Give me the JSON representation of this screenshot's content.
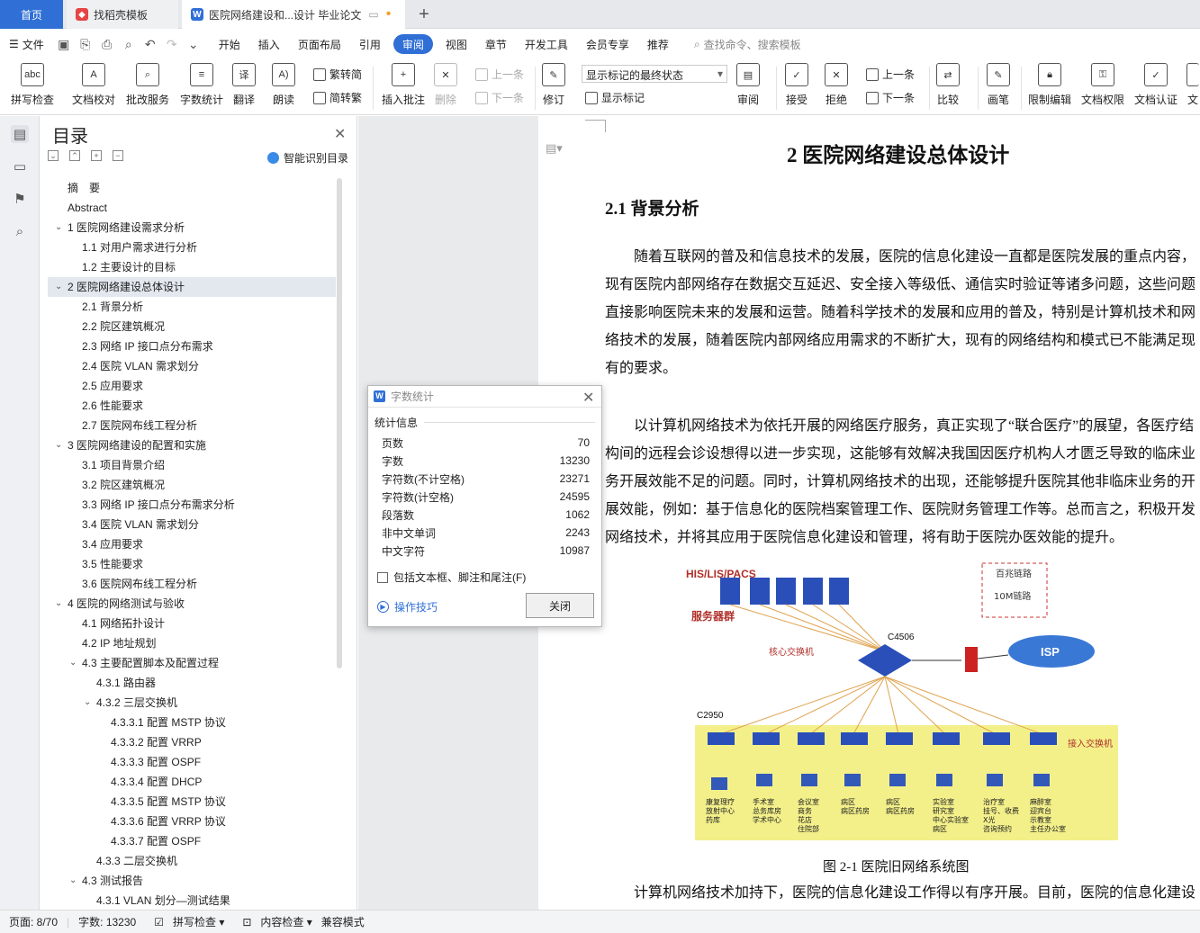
{
  "tabs": {
    "home": "首页",
    "templates": "找稻壳模板",
    "document": "医院网络建设和...设计 毕业论文",
    "add": "+"
  },
  "menu": {
    "file": "文件",
    "items": [
      "开始",
      "插入",
      "页面布局",
      "引用",
      "审阅",
      "视图",
      "章节",
      "开发工具",
      "会员专享",
      "推荐"
    ],
    "active": "审阅",
    "search": "查找命令、搜索模板"
  },
  "ribbon": {
    "spell": "拼写检查",
    "proof": "文档校对",
    "batch": "批改服务",
    "wordcount": "字数统计",
    "translate": "翻译",
    "read": "朗读",
    "trad": "繁转简",
    "simp": "简转繁",
    "insert_comment": "插入批注",
    "delete": "删除",
    "prev1": "上一条",
    "next1": "下一条",
    "revise": "修订",
    "markup_state": "显示标记的最终状态",
    "show_markup": "显示标记",
    "review": "审阅",
    "accept": "接受",
    "reject": "拒绝",
    "prev2": "上一条",
    "next2": "下一条",
    "compare": "比较",
    "pen": "画笔",
    "restrict": "限制编辑",
    "perm": "文档权限",
    "cert": "文档认证",
    "more": "文"
  },
  "toc": {
    "title": "目录",
    "smart": "智能识别目录",
    "items": [
      {
        "t": "摘　要",
        "l": 0
      },
      {
        "t": "Abstract",
        "l": 0
      },
      {
        "t": "1 医院网络建设需求分析",
        "l": 1,
        "c": 1
      },
      {
        "t": "1.1 对用户需求进行分析",
        "l": 2
      },
      {
        "t": "1.2 主要设计的目标",
        "l": 2
      },
      {
        "t": "2 医院网络建设总体设计",
        "l": 1,
        "c": 1,
        "sel": 1
      },
      {
        "t": "2.1 背景分析",
        "l": 2
      },
      {
        "t": "2.2 院区建筑概况",
        "l": 2
      },
      {
        "t": "2.3 网络 IP 接口点分布需求",
        "l": 2
      },
      {
        "t": "2.4 医院 VLAN 需求划分",
        "l": 2
      },
      {
        "t": "2.5 应用要求",
        "l": 2
      },
      {
        "t": "2.6 性能要求",
        "l": 2
      },
      {
        "t": "2.7 医院网布线工程分析",
        "l": 2
      },
      {
        "t": "3 医院网络建设的配置和实施",
        "l": 1,
        "c": 1
      },
      {
        "t": "3.1 项目背景介绍",
        "l": 2
      },
      {
        "t": "3.2 院区建筑概况",
        "l": 2
      },
      {
        "t": "3.3 网络 IP 接口点分布需求分析",
        "l": 2
      },
      {
        "t": "3.4 医院 VLAN 需求划分",
        "l": 2
      },
      {
        "t": "3.4 应用要求",
        "l": 2
      },
      {
        "t": "3.5 性能要求",
        "l": 2
      },
      {
        "t": "3.6 医院网布线工程分析",
        "l": 2
      },
      {
        "t": "4 医院的网络测试与验收",
        "l": 1,
        "c": 1
      },
      {
        "t": "4.1 网络拓扑设计",
        "l": 2
      },
      {
        "t": "4.2 IP 地址规划",
        "l": 2
      },
      {
        "t": "4.3 主要配置脚本及配置过程",
        "l": 2,
        "c": 1
      },
      {
        "t": "4.3.1 路由器",
        "l": 3
      },
      {
        "t": "4.3.2 三层交换机",
        "l": 3,
        "c": 1
      },
      {
        "t": "4.3.3.1 配置 MSTP 协议",
        "l": 4
      },
      {
        "t": "4.3.3.2 配置 VRRP",
        "l": 4
      },
      {
        "t": "4.3.3.3 配置 OSPF",
        "l": 4
      },
      {
        "t": "4.3.3.4 配置 DHCP",
        "l": 4
      },
      {
        "t": "4.3.3.5 配置 MSTP 协议",
        "l": 4
      },
      {
        "t": "4.3.3.6 配置 VRRP 协议",
        "l": 4
      },
      {
        "t": "4.3.3.7 配置 OSPF",
        "l": 4
      },
      {
        "t": "4.3.3 二层交换机",
        "l": 3
      },
      {
        "t": "4.3 测试报告",
        "l": 2,
        "c": 1
      },
      {
        "t": "4.3.1 VLAN 划分—测试结果",
        "l": 3
      }
    ]
  },
  "doc": {
    "h1": "2 医院网络建设总体设计",
    "h2": "2.1 背景分析",
    "p1": "随着互联网的普及和信息技术的发展，医院的信息化建设一直都是医院发展的重点内容，现有医院内部网络存在数据交互延迟、安全接入等级低、通信实时验证等诸多问题，这些问题直接影响医院未来的发展和运营。随着科学技术的发展和应用的普及，特别是计算机技术和网络技术的发展，随着医院内部网络应用需求的不断扩大，现有的网络结构和模式已不能满足现有的要求。",
    "p2": "以计算机网络技术为依托开展的网络医疗服务，真正实现了“联合医疗”的展望，各医疗结构间的远程会诊设想得以进一步实现，这能够有效解决我国因医疗机构人才匮乏导致的临床业务开展效能不足的问题。同时，计算机网络技术的出现，还能够提升医院其他非临床业务的开展效能，例如：基于信息化的医院档案管理工作、医院财务管理工作等。总而言之，积极开发网络技术，并将其应用于医院信息化建设和管理，将有助于医院办医效能的提升。",
    "caption": "图 2-1  医院旧网络系统图",
    "p3": "计算机网络技术加持下，医院的信息化建设工作得以有序开展。目前，医院的信息化建设"
  },
  "figure": {
    "servers": "HIS/LIS/PACS",
    "server_group": "服务器群",
    "core_label": "核心交换机",
    "core": "C4506",
    "isp": "ISP",
    "legend1": "百兆链路",
    "legend2": "10M链路",
    "c2950": "C2950",
    "access": "接入交换机",
    "depts": [
      "康复理疗\n放射中心\n药库",
      "手术室\n总务库房\n学术中心",
      "会议室\n商务\n花店\n住院部",
      "病区\n病区药房",
      "病区\n病区药房",
      "实验室\n研究室\n中心实验室\n病区",
      "治疗室\n挂号、收费\nX光\n咨询预约",
      "麻醉室\n迎宾台\n示教室\n主任办公室"
    ]
  },
  "dialog": {
    "title": "字数统计",
    "section": "统计信息",
    "rows": [
      [
        "页数",
        "70"
      ],
      [
        "字数",
        "13230"
      ],
      [
        "字符数(不计空格)",
        "23271"
      ],
      [
        "字符数(计空格)",
        "24595"
      ],
      [
        "段落数",
        "1062"
      ],
      [
        "非中文单词",
        "2243"
      ],
      [
        "中文字符",
        "10987"
      ]
    ],
    "checkbox": "包括文本框、脚注和尾注(F)",
    "tip": "操作技巧",
    "close": "关闭"
  },
  "status": {
    "page": "页面: 8/70",
    "words": "字数: 13230",
    "spell": "拼写检查",
    "content": "内容检查",
    "mode": "兼容模式"
  }
}
